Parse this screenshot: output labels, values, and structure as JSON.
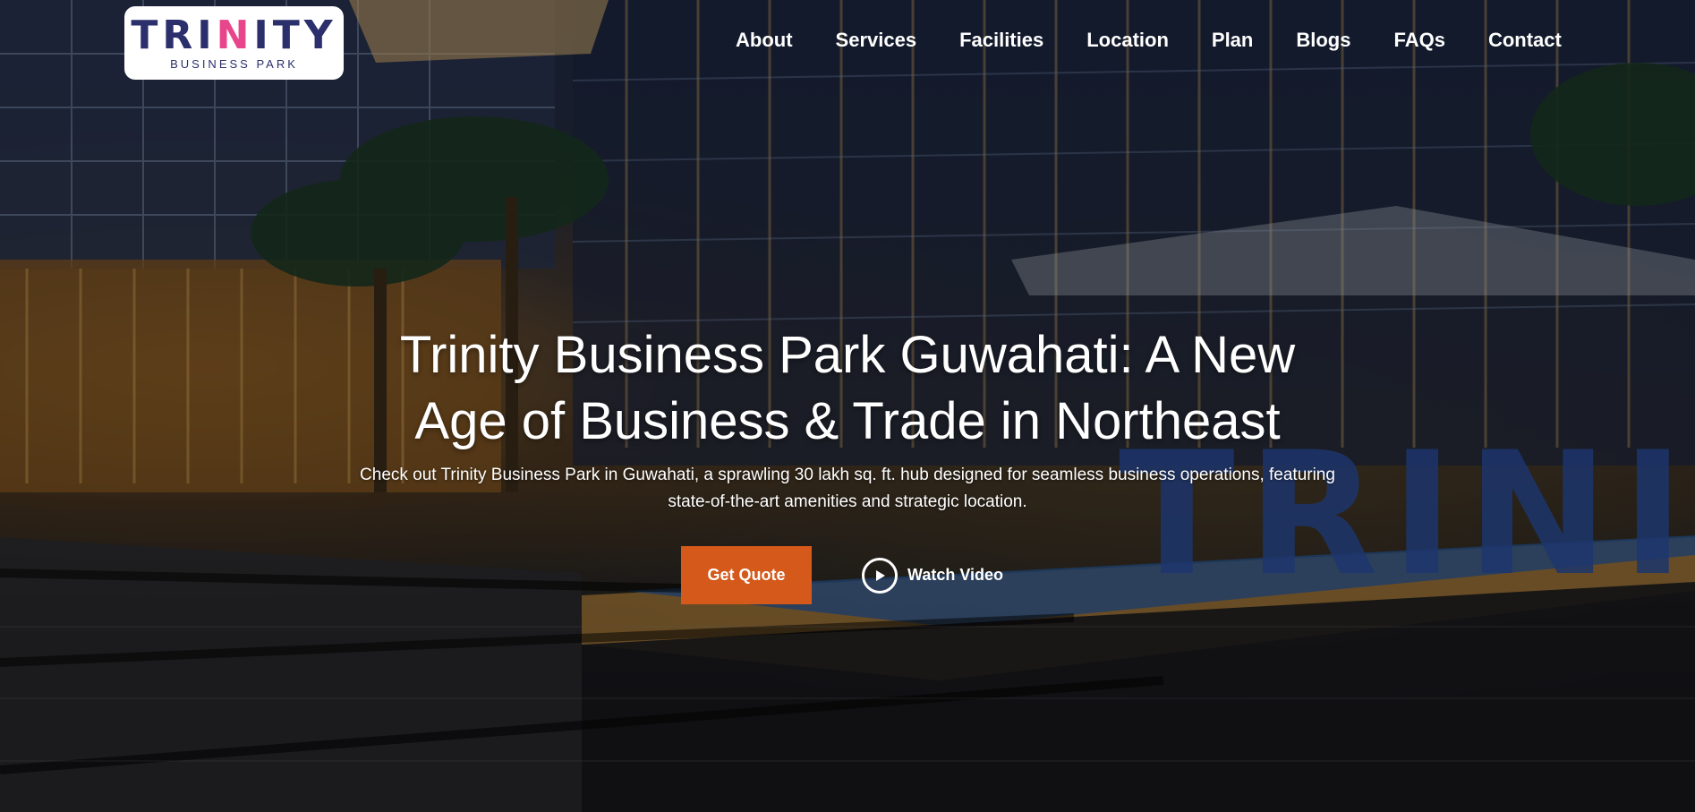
{
  "brand": {
    "logo_word": "TRINITY",
    "logo_sub": "BUSINESS PARK",
    "logo_colors": [
      "#2b2f6b",
      "#e8468b",
      "#2fa84f",
      "#f29a1f"
    ]
  },
  "nav": {
    "items": [
      {
        "label": "About"
      },
      {
        "label": "Services"
      },
      {
        "label": "Facilities"
      },
      {
        "label": "Location"
      },
      {
        "label": "Plan"
      },
      {
        "label": "Blogs"
      },
      {
        "label": "FAQs"
      },
      {
        "label": "Contact"
      }
    ]
  },
  "hero": {
    "title": "Trinity Business Park Guwahati: A New Age of Business & Trade in Northeast",
    "subtitle": "Check out Trinity Business Park in Guwahati, a sprawling 30 lakh sq. ft. hub designed for seamless business operations, featuring state-of-the-art amenities and strategic location.",
    "cta_primary": "Get Quote",
    "cta_secondary": "Watch Video",
    "cta_secondary_icon": "play-circle-icon",
    "accent_color": "#d4591a",
    "sign_text": "TRINITY"
  }
}
